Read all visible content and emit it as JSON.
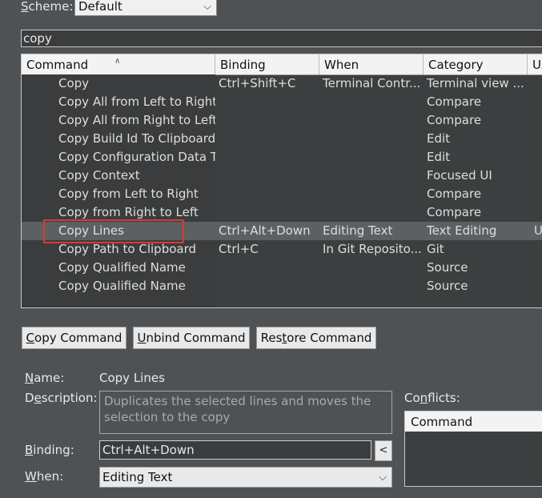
{
  "scheme": {
    "label_pre": "",
    "label_u": "S",
    "label_post": "cheme:",
    "value": "Default"
  },
  "filter": {
    "value": "copy"
  },
  "table": {
    "columns": [
      "Command",
      "Binding",
      "When",
      "Category",
      "Us"
    ],
    "rows": [
      {
        "command": "Copy",
        "binding": "Ctrl+Shift+C",
        "when": "Terminal Contr...",
        "category": "Terminal view ...",
        "user": ""
      },
      {
        "command": "Copy All from Left to Right",
        "binding": "",
        "when": "",
        "category": "Compare",
        "user": ""
      },
      {
        "command": "Copy All from Right to Left",
        "binding": "",
        "when": "",
        "category": "Compare",
        "user": ""
      },
      {
        "command": "Copy Build Id To Clipboard",
        "binding": "",
        "when": "",
        "category": "Edit",
        "user": ""
      },
      {
        "command": "Copy Configuration Data To",
        "binding": "",
        "when": "",
        "category": "Edit",
        "user": ""
      },
      {
        "command": "Copy Context",
        "binding": "",
        "when": "",
        "category": "Focused UI",
        "user": ""
      },
      {
        "command": "Copy from Left to Right",
        "binding": "",
        "when": "",
        "category": "Compare",
        "user": ""
      },
      {
        "command": "Copy from Right to Left",
        "binding": "",
        "when": "",
        "category": "Compare",
        "user": ""
      },
      {
        "command": "Copy Lines",
        "binding": "Ctrl+Alt+Down",
        "when": "Editing Text",
        "category": "Text Editing",
        "user": "U"
      },
      {
        "command": "Copy Path to Clipboard",
        "binding": "Ctrl+C",
        "when": "In Git Reposito...",
        "category": "Git",
        "user": ""
      },
      {
        "command": "Copy Qualified Name",
        "binding": "",
        "when": "",
        "category": "Source",
        "user": ""
      },
      {
        "command": "Copy Qualified Name",
        "binding": "",
        "when": "",
        "category": "Source",
        "user": ""
      }
    ]
  },
  "buttons": {
    "copy": {
      "u": "C",
      "rest": "opy Command"
    },
    "unbind": {
      "u": "U",
      "rest": "nbind Command"
    },
    "restore": {
      "pre": "Res",
      "u": "t",
      "rest": "ore Command"
    }
  },
  "details": {
    "name_label": {
      "u": "N",
      "rest": "ame:"
    },
    "name_value": "Copy Lines",
    "description_label": {
      "pre": "D",
      "u": "e",
      "rest": "scription:"
    },
    "description_value": "Duplicates the selected lines and moves the selection to the copy",
    "binding_label": {
      "u": "B",
      "rest": "inding:"
    },
    "binding_value": "Ctrl+Alt+Down",
    "binding_button": "<",
    "when_label": {
      "u": "W",
      "rest": "hen:"
    },
    "when_value": "Editing Text",
    "conflicts_label": {
      "pre": "Co",
      "u": "n",
      "rest": "flicts:"
    },
    "conflicts_column": "Command"
  },
  "selected_row_index": 8,
  "colors": {
    "background": "#4f5254",
    "table_bg": "#3c3f40",
    "highlight": "#d83a35"
  }
}
